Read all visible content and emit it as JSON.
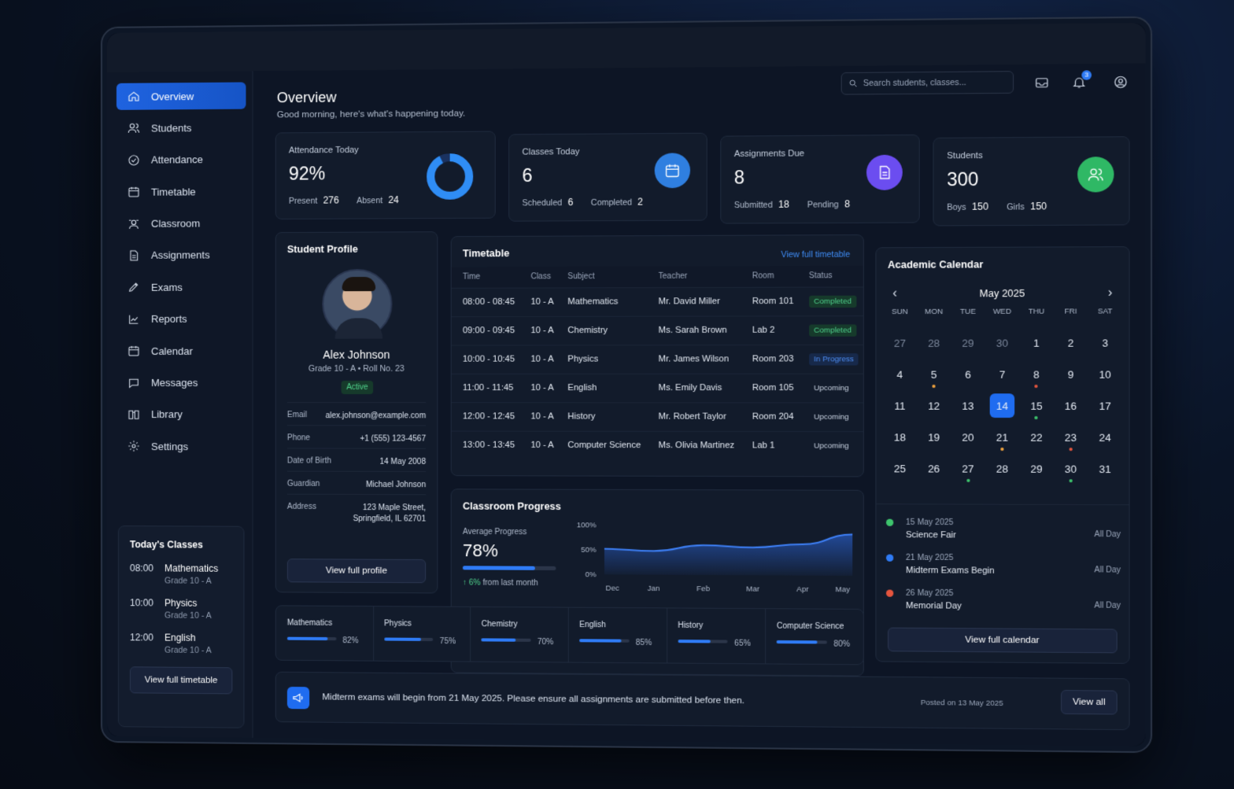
{
  "sidebar": {
    "items": [
      "Overview",
      "Students",
      "Attendance",
      "Timetable",
      "Classroom",
      "Assignments",
      "Exams",
      "Reports",
      "Calendar",
      "Messages",
      "Library",
      "Settings"
    ]
  },
  "today_classes": {
    "title": "Today's Classes",
    "items": [
      {
        "time": "08:00",
        "subject": "Mathematics",
        "grade": "Grade 10 - A"
      },
      {
        "time": "10:00",
        "subject": "Physics",
        "grade": "Grade 10 - A"
      },
      {
        "time": "12:00",
        "subject": "English",
        "grade": "Grade 10 - A"
      }
    ],
    "button": "View full timetable"
  },
  "header": {
    "search_placeholder": "Search students, classes...",
    "notifications": "3"
  },
  "page": {
    "title": "Overview",
    "subtitle": "Good morning, here's what's happening today."
  },
  "stats": {
    "attendance": {
      "label": "Attendance Today",
      "value": "92%",
      "present_label": "Present",
      "present": "276",
      "absent_label": "Absent",
      "absent": "24",
      "percent": 92
    },
    "classes": {
      "label": "Classes Today",
      "value": "6",
      "a_label": "Scheduled",
      "a": "6",
      "b_label": "Completed",
      "b": "2"
    },
    "assignments": {
      "label": "Assignments Due",
      "value": "8",
      "a_label": "Submitted",
      "a": "18",
      "b_label": "Pending",
      "b": "8"
    },
    "students": {
      "label": "Students",
      "value": "300",
      "a_label": "Boys",
      "a": "150",
      "b_label": "Girls",
      "b": "150"
    }
  },
  "profile": {
    "title": "Student Profile",
    "name": "Alex Johnson",
    "meta": "Grade 10 - A • Roll No. 23",
    "status": "Active",
    "fields": [
      {
        "k": "Email",
        "v": "alex.johnson@example.com"
      },
      {
        "k": "Phone",
        "v": "+1 (555) 123-4567"
      },
      {
        "k": "Date of Birth",
        "v": "14 May 2008"
      },
      {
        "k": "Guardian",
        "v": "Michael Johnson"
      },
      {
        "k": "Address",
        "v": "123 Maple Street,\nSpringfield, IL 62701"
      }
    ],
    "button": "View full profile"
  },
  "timetable": {
    "title": "Timetable",
    "link": "View full timetable",
    "headers": [
      "Time",
      "Class",
      "Subject",
      "Teacher",
      "Room",
      "Status"
    ],
    "rows": [
      [
        "08:00 - 08:45",
        "10 - A",
        "Mathematics",
        "Mr. David Miller",
        "Room 101",
        "Completed"
      ],
      [
        "09:00 - 09:45",
        "10 - A",
        "Chemistry",
        "Ms. Sarah Brown",
        "Lab 2",
        "Completed"
      ],
      [
        "10:00 - 10:45",
        "10 - A",
        "Physics",
        "Mr. James Wilson",
        "Room 203",
        "In Progress"
      ],
      [
        "11:00 - 11:45",
        "10 - A",
        "English",
        "Ms. Emily Davis",
        "Room 105",
        "Upcoming"
      ],
      [
        "12:00 - 12:45",
        "10 - A",
        "History",
        "Mr. Robert Taylor",
        "Room 204",
        "Upcoming"
      ],
      [
        "13:00 - 13:45",
        "10 - A",
        "Computer Science",
        "Ms. Olivia Martinez",
        "Lab 1",
        "Upcoming"
      ]
    ]
  },
  "progress": {
    "title": "Classroom Progress",
    "avg_label": "Average Progress",
    "avg": "78%",
    "avg_value": 78,
    "trend": "6%",
    "trend_text": "from last month"
  },
  "chart_data": {
    "type": "area",
    "x": [
      "Dec",
      "Jan",
      "Feb",
      "Mar",
      "Apr",
      "May"
    ],
    "values": [
      52,
      48,
      60,
      56,
      63,
      83
    ],
    "y_ticks": [
      "100%",
      "50%",
      "0%"
    ],
    "ylim": [
      0,
      100
    ]
  },
  "subjects": [
    {
      "name": "Mathematics",
      "pct": "82%",
      "v": 82
    },
    {
      "name": "Physics",
      "pct": "75%",
      "v": 75
    },
    {
      "name": "Chemistry",
      "pct": "70%",
      "v": 70
    },
    {
      "name": "English",
      "pct": "85%",
      "v": 85
    },
    {
      "name": "History",
      "pct": "65%",
      "v": 65
    },
    {
      "name": "Computer Science",
      "pct": "80%",
      "v": 80
    }
  ],
  "calendar": {
    "title": "Academic Calendar",
    "month": "May 2025",
    "days": [
      "SUN",
      "MON",
      "TUE",
      "WED",
      "THU",
      "FRI",
      "SAT"
    ],
    "cells": [
      "27",
      "28",
      "29",
      "30",
      "1",
      "2",
      "3",
      "4",
      "5",
      "6",
      "7",
      "8",
      "9",
      "10",
      "11",
      "12",
      "13",
      "14",
      "15",
      "16",
      "17",
      "18",
      "19",
      "20",
      "21",
      "22",
      "23",
      "24",
      "25",
      "26",
      "27",
      "28",
      "29",
      "30",
      "31"
    ],
    "events": [
      {
        "date": "15 May 2025",
        "name": "Science Fair",
        "when": "All Day",
        "color": "#3ec46d"
      },
      {
        "date": "21 May 2025",
        "name": "Midterm Exams Begin",
        "when": "All Day",
        "color": "#2f7bf5"
      },
      {
        "date": "26 May 2025",
        "name": "Memorial Day",
        "when": "All Day",
        "color": "#e5553e"
      }
    ],
    "button": "View full calendar"
  },
  "announcement": {
    "text": "Midterm exams will begin from 21 May 2025. Please ensure all assignments are submitted before then.",
    "posted": "Posted on 13 May 2025",
    "button": "View all"
  },
  "colors": {
    "accent": "#1f6cf0",
    "green": "#3ec46d",
    "purple": "#6b4df0",
    "orange": "#f0a23e",
    "red": "#e5553e"
  }
}
